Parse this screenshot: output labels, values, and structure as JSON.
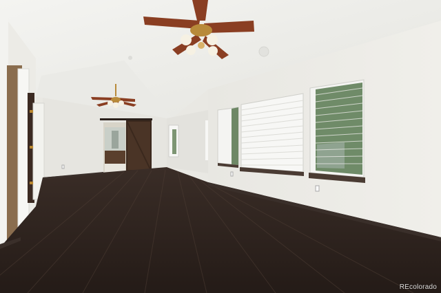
{
  "watermark": "REcolorado",
  "colors": {
    "ceiling": "#f2f2ef",
    "wall_right": "#eeede8",
    "wall_back": "#e6e5e0",
    "floor_dark": "#2f2520",
    "floor_light": "#4a3b33",
    "baseboard": "#3a2f2a",
    "barn_door": "#4a3426",
    "fan_blade": "#8a3e22",
    "fan_brass": "#b88a3a",
    "window_blind": "#f5f5f3",
    "foliage": "#5f7a58"
  },
  "icons": [
    "ceiling-fan-icon",
    "window-blinds-icon",
    "barn-door-icon"
  ]
}
